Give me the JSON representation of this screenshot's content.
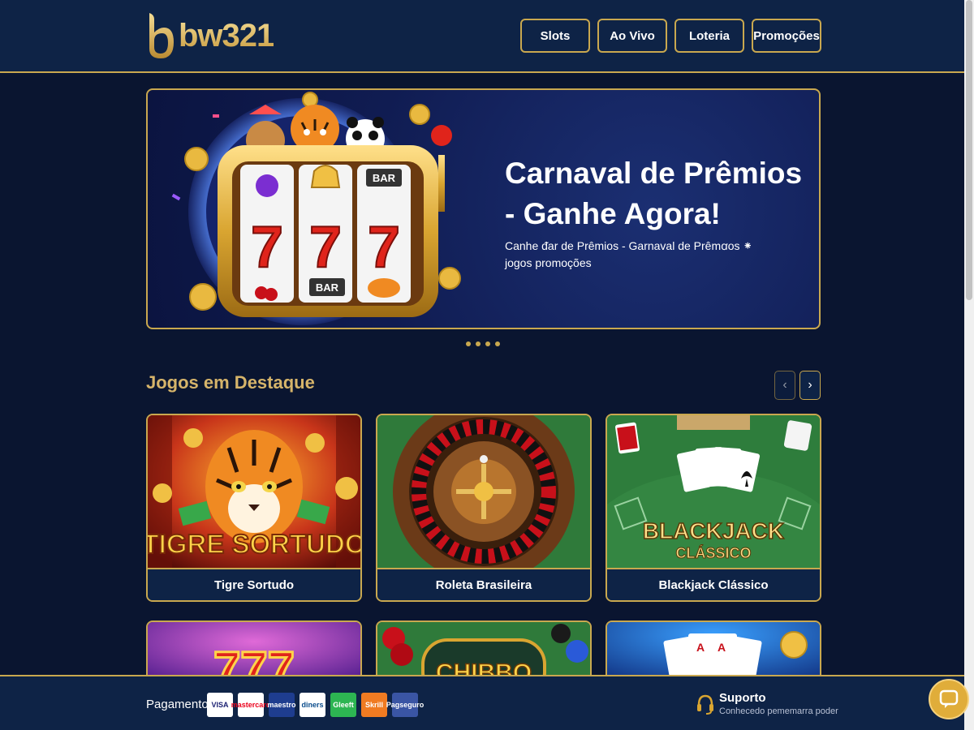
{
  "brand": {
    "name": "bw321"
  },
  "nav": [
    {
      "label": "Slots"
    },
    {
      "label": "Ao Vivo"
    },
    {
      "label": "Loteria"
    },
    {
      "label": "Promoções"
    }
  ],
  "hero": {
    "title": "Carnaval de Prêmios - Ganhe Agora!",
    "subtitle": "Canhe ᵭar de Prêmios - Garnaval de Prêmꭤos ⁕ jogos promoções",
    "slides": 4,
    "active_slide": 1,
    "reel_labels": [
      "BAR",
      "BAR"
    ]
  },
  "featured": {
    "title": "Jogos em Destaque",
    "prev_icon": "chevron-left-icon",
    "next_icon": "chevron-right-icon",
    "games": [
      {
        "name": "Tigre Sortudo",
        "art_text": "TIGRE SORTUDO"
      },
      {
        "name": "Roleta Brasileira"
      },
      {
        "name": "Blackjack Clássico",
        "art_text": [
          "BLACKJACK",
          "CLÁSSICO"
        ]
      }
    ],
    "games_row2": [
      {
        "art": "777-slot"
      },
      {
        "art": "chips-table",
        "art_text": "CHIBBO"
      },
      {
        "art": "playing-cards"
      }
    ]
  },
  "footer": {
    "payment_label": "Pagamento:",
    "payment_methods": [
      {
        "name": "VISA",
        "bg": "#ffffff",
        "fg": "#1a1f71"
      },
      {
        "name": "mastercard",
        "bg": "#ffffff",
        "fg": "#eb001b"
      },
      {
        "name": "maestro",
        "bg": "#1e3d8f",
        "fg": "#ffffff"
      },
      {
        "name": "diners",
        "bg": "#ffffff",
        "fg": "#0a4c8c"
      },
      {
        "name": "Gleeft",
        "bg": "#2db552",
        "fg": "#ffffff"
      },
      {
        "name": "Skrill",
        "bg": "#f07b22",
        "fg": "#ffffff"
      },
      {
        "name": "Pagseguro",
        "bg": "#3a55a4",
        "fg": "#ffffff"
      }
    ],
    "support_title": "Suporto",
    "support_subtitle": "Conhecedo pememarra poder"
  },
  "colors": {
    "accent_gold": "#c9a84f",
    "bg": "#0a1530",
    "panel": "#0e2346"
  }
}
